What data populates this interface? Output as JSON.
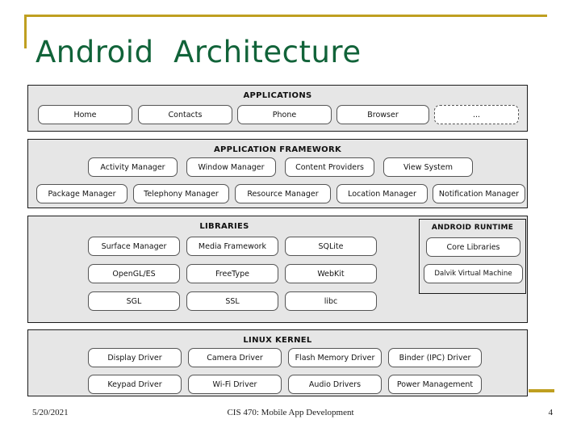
{
  "slide": {
    "title": "Android  Architecture",
    "accent_color": "#bf9f20",
    "title_color": "#116339",
    "layer_fill": "#e6e6e6",
    "node_fill": "#ffffff"
  },
  "diagram": {
    "layers": [
      {
        "id": "applications",
        "heading": "APPLICATIONS",
        "rows": [
          [
            "Home",
            "Contacts",
            "Phone",
            "Browser",
            "..."
          ]
        ]
      },
      {
        "id": "framework",
        "heading": "APPLICATION FRAMEWORK",
        "rows": [
          [
            "Activity Manager",
            "Window Manager",
            "Content Providers",
            "View System"
          ],
          [
            "Package Manager",
            "Telephony Manager",
            "Resource Manager",
            "Location Manager",
            "Notification Manager"
          ]
        ]
      },
      {
        "id": "libraries",
        "heading": "LIBRARIES",
        "rows": [
          [
            "Surface Manager",
            "Media Framework",
            "SQLite"
          ],
          [
            "OpenGL/ES",
            "FreeType",
            "WebKit"
          ],
          [
            "SGL",
            "SSL",
            "libc"
          ]
        ]
      },
      {
        "id": "runtime",
        "heading": "ANDROID RUNTIME",
        "rows": [
          [
            "Core Libraries"
          ],
          [
            "Dalvik Virtual Machine"
          ]
        ]
      },
      {
        "id": "kernel",
        "heading": "LINUX KERNEL",
        "rows": [
          [
            "Display Driver",
            "Camera Driver",
            "Flash Memory Driver",
            "Binder (IPC) Driver"
          ],
          [
            "Keypad Driver",
            "Wi-Fi Driver",
            "Audio Drivers",
            "Power Management"
          ]
        ]
      }
    ]
  },
  "footer": {
    "date": "5/20/2021",
    "course": "CIS 470: Mobile App Development",
    "page_number": "4"
  }
}
